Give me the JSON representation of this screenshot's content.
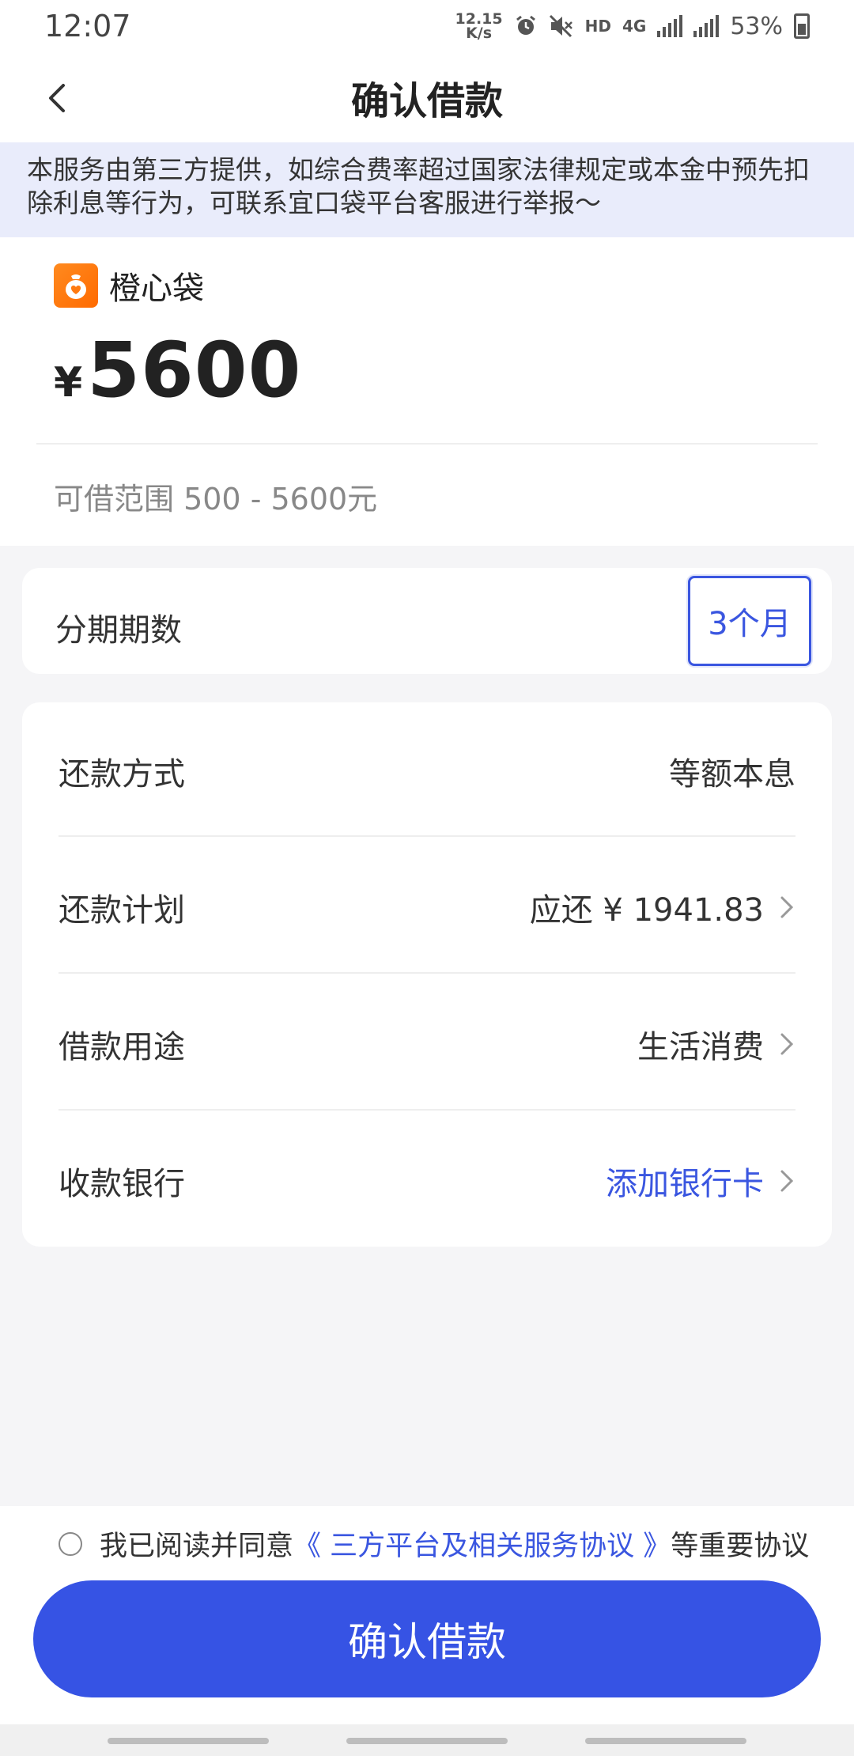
{
  "status_bar": {
    "time": "12:07",
    "speed_top": "12.15",
    "speed_bottom": "K/s",
    "hd": "HD",
    "network": "4G",
    "battery": "53%"
  },
  "nav": {
    "title": "确认借款"
  },
  "notice": {
    "text": "本服务由第三方提供，如综合费率超过国家法律规定或本金中预先扣除利息等行为，可联系宜口袋平台客服进行举报～"
  },
  "loan": {
    "brand_name": "橙心袋",
    "currency": "¥",
    "amount": "5600",
    "range": "可借范围 500 - 5600元"
  },
  "term": {
    "label": "分期期数",
    "value": "3个月"
  },
  "details": {
    "repay_method_label": "还款方式",
    "repay_method_value": "等额本息",
    "repay_plan_label": "还款计划",
    "repay_plan_value": "应还 ¥ 1941.83",
    "purpose_label": "借款用途",
    "purpose_value": "生活消费",
    "bank_label": "收款银行",
    "bank_value": "添加银行卡"
  },
  "agreement": {
    "prefix": "我已阅读并同意",
    "link": "《 三方平台及相关服务协议 》",
    "suffix": "等重要协议"
  },
  "confirm_button": "确认借款",
  "colors": {
    "primary": "#3653e4",
    "notice_bg": "#e9ecfb",
    "brand_orange": "#ff7a10"
  }
}
